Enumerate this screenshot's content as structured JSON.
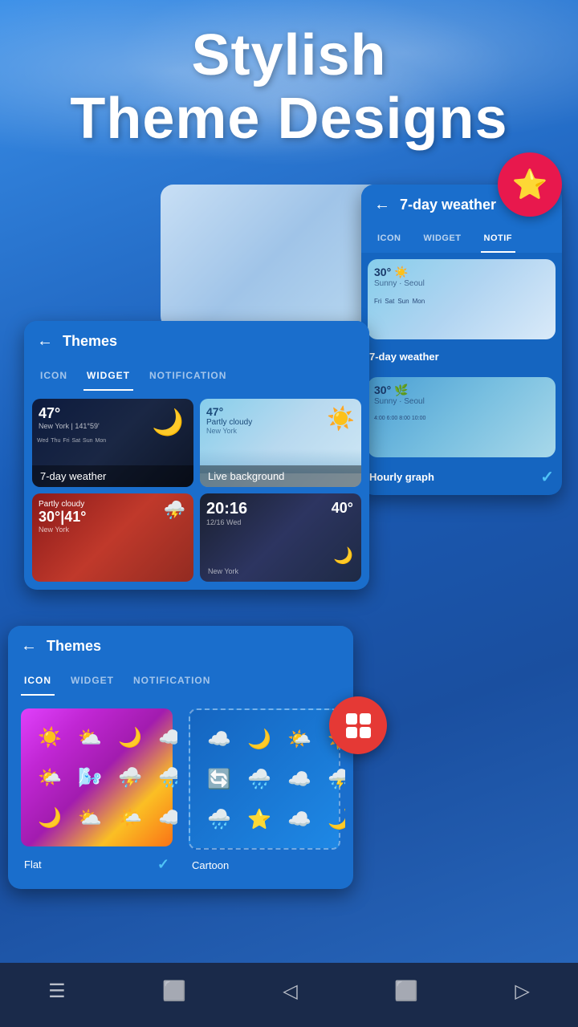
{
  "app": {
    "hero_line1": "Stylish",
    "hero_line2": "Theme Designs"
  },
  "star_badge": "⭐",
  "panel_back": {
    "tabs": [
      "ICON",
      "WIDGET",
      "NOTIFICATION"
    ],
    "active_tab": "NOTIFICATION",
    "card1": {
      "label": "7-day weather",
      "temp": "30°",
      "condition": "Sunny",
      "location": "Seoul"
    },
    "card2": {
      "label": "Hourly graph",
      "temp": "30°",
      "has_check": true
    }
  },
  "panel_mid": {
    "title": "Themes",
    "tabs": [
      "ICON",
      "WIDGET",
      "NOTIFICATION"
    ],
    "active_tab": "WIDGET",
    "cards": [
      {
        "id": "night-7day",
        "temp": "47°",
        "location": "New York",
        "sublocation": "141°59'",
        "label": "7-day weather",
        "style": "night"
      },
      {
        "id": "day-live",
        "temp": "47°",
        "condition": "Partly cloudy",
        "location": "New York",
        "label": "Live background",
        "style": "day"
      },
      {
        "id": "thunder",
        "label": "",
        "style": "thunder"
      },
      {
        "id": "dark-time",
        "time": "20:16",
        "temp": "40°",
        "label": "",
        "style": "dark"
      }
    ]
  },
  "panel_bottom": {
    "title": "Themes",
    "tabs": [
      "ICON",
      "WIDGET",
      "NOTIFICATION"
    ],
    "active_tab": "ICON",
    "themes": [
      {
        "id": "flat",
        "name": "Flat",
        "has_check": true,
        "icons": [
          "☀️",
          "⛅",
          "🌙",
          "☁️",
          "🌤️",
          "🌬️",
          "⛈️",
          "🌧️",
          "🌙",
          "⛅",
          "⛅",
          "☁️"
        ]
      },
      {
        "id": "cartoon",
        "name": "Cartoon",
        "has_check": false,
        "icons": [
          "☁️",
          "🌙",
          "🌤️",
          "☀️",
          "🔄",
          "🌧️",
          "☁️",
          "⛈️",
          "🌧️",
          "⭐",
          "☁️",
          "🌙"
        ]
      }
    ]
  },
  "nav": {
    "items": [
      "☰",
      "⬜",
      "◁",
      "⬜",
      "▷"
    ]
  }
}
